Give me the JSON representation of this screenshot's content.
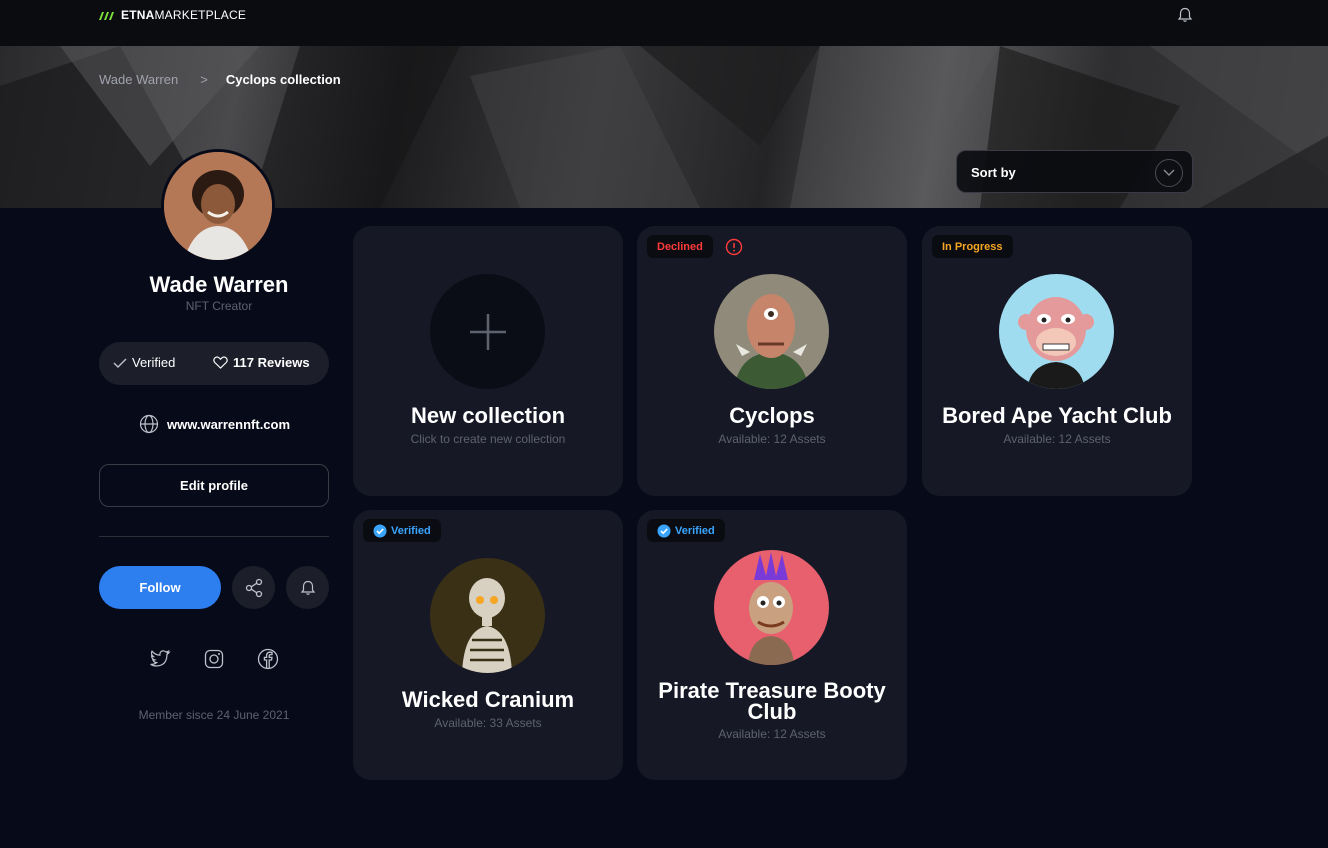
{
  "header": {
    "logo_bold": "ETNA",
    "logo_regular": "MARKETPLACE"
  },
  "breadcrumb": {
    "parent": "Wade Warren",
    "separator": ">",
    "current": "Cyclops collection"
  },
  "sort": {
    "label": "Sort by"
  },
  "profile": {
    "name": "Wade Warren",
    "role": "NFT Creator",
    "verified_label": "Verified",
    "reviews_label": "117 Reviews",
    "website": "www.warrennft.com",
    "edit_label": "Edit profile",
    "follow_label": "Follow",
    "member_since": "Member sisce 24 June 2021"
  },
  "new_collection": {
    "title": "New collection",
    "subtitle": "Click to create new collection"
  },
  "collections": [
    {
      "status": "Declined",
      "status_color": "#ff3b3b",
      "title": "Cyclops",
      "subtitle": "Available: 12 Assets",
      "bg": "#8f8a7a"
    },
    {
      "status": "In Progress",
      "status_color": "#f5a623",
      "title": "Bored Ape Yacht Club",
      "subtitle": "Available: 12 Assets",
      "bg": "#9fdcf0"
    },
    {
      "status": "Verified",
      "status_color": "#3aa5ff",
      "title": "Wicked Cranium",
      "subtitle": "Available: 33 Assets",
      "bg": "#3a3016"
    },
    {
      "status": "Verified",
      "status_color": "#3aa5ff",
      "title": "Pirate Treasure Booty Club",
      "subtitle": "Available: 12 Assets",
      "bg": "#e8606e"
    }
  ],
  "colors": {
    "accent": "#2d7ff0",
    "background": "#070a18",
    "card": "#161925"
  }
}
